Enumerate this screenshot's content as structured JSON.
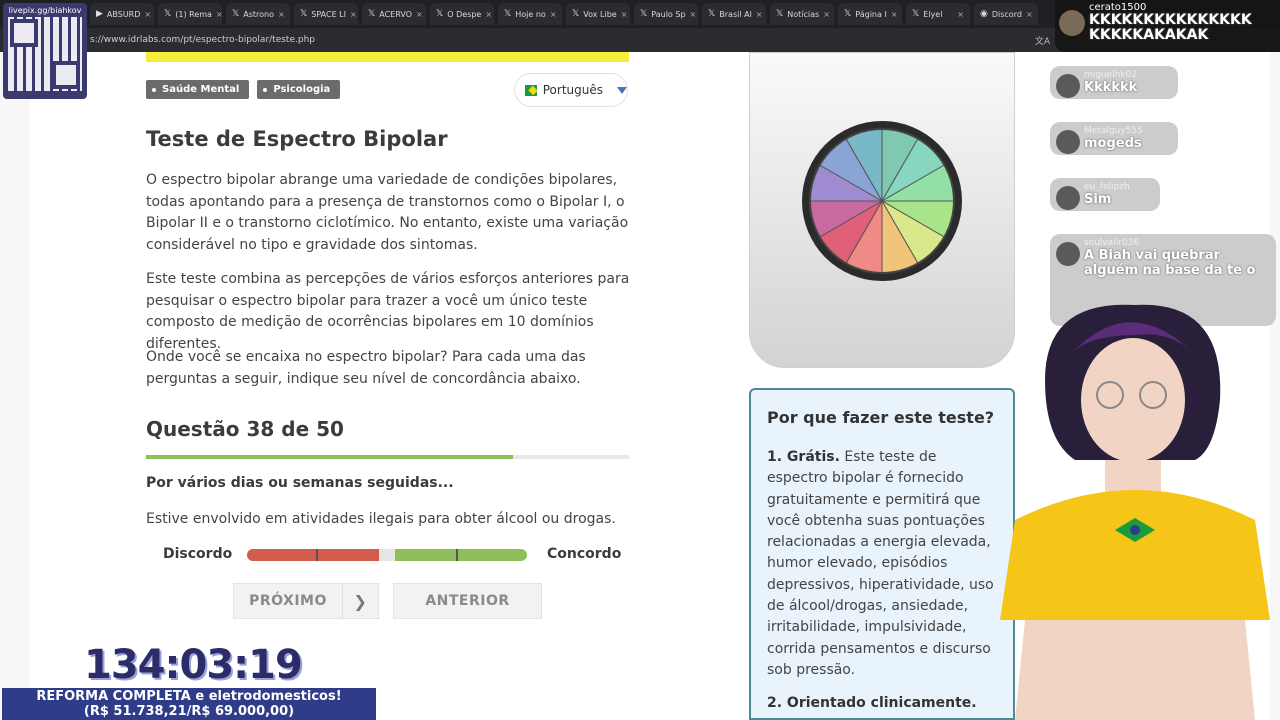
{
  "browser": {
    "tabs": [
      {
        "icon": "youtube-icon",
        "label": "ABSURD"
      },
      {
        "icon": "x-icon",
        "label": "(1) Rema"
      },
      {
        "icon": "x-icon",
        "label": "Astrono"
      },
      {
        "icon": "x-icon",
        "label": "SPACE LI"
      },
      {
        "icon": "x-icon",
        "label": "ACERVO"
      },
      {
        "icon": "x-icon",
        "label": "O Despe"
      },
      {
        "icon": "x-icon",
        "label": "Hoje no"
      },
      {
        "icon": "x-icon",
        "label": "Vox Libe"
      },
      {
        "icon": "x-icon",
        "label": "Paulo Sp"
      },
      {
        "icon": "x-icon",
        "label": "Brasil Al"
      },
      {
        "icon": "x-icon",
        "label": "Notícias"
      },
      {
        "icon": "x-icon",
        "label": "Página I"
      },
      {
        "icon": "x-icon",
        "label": "Elyel"
      },
      {
        "icon": "discord-icon",
        "label": "Discord"
      }
    ],
    "url": "s://www.idrlabs.com/pt/espectro-bipolar/teste.php"
  },
  "page": {
    "tags": [
      "Saúde Mental",
      "Psicologia"
    ],
    "language": "Português",
    "title": "Teste de Espectro Bipolar",
    "intro_1": "O espectro bipolar abrange uma variedade de condições bipolares, todas apontando para a presença de transtornos como o Bipolar I, o Bipolar II e o transtorno ciclotímico. No entanto, existe uma variação considerável no tipo e gravidade dos sintomas.",
    "intro_2": "Este teste combina as percepções de vários esforços anteriores para pesquisar o espectro bipolar para trazer a você um único teste composto de medição de ocorrências bipolares em 10 domínios diferentes.",
    "intro_3": "Onde você se encaixa no espectro bipolar? Para cada uma das perguntas a seguir, indique seu nível de concordância abaixo.",
    "question_number": "Questão 38 de 50",
    "progress": 0.76,
    "question_header": "Por vários dias ou semanas seguidas...",
    "question_text": "Estive envolvido em atividades ilegais para obter álcool ou drogas.",
    "scale_left": "Discordo",
    "scale_right": "Concordo",
    "slider_value": 0.5,
    "next_label": "PRÓXIMO",
    "prev_label": "ANTERIOR"
  },
  "sidebar": {
    "panel_title": "Por que fazer este teste?",
    "item1_title": "1. Grátis.",
    "item1_text": " Este teste de espectro bipolar é fornecido gratuitamente e permitirá que você obtenha suas pontuações relacionadas a energia elevada, humor elevado, episódios depressivos, hiperatividade, uso de álcool/drogas, ansiedade, irritabilidade, impulsividade, corrida pensamentos e discurso sob pressão.",
    "item2_title": "2. Orientado clinicamente."
  },
  "overlay": {
    "qr_handle": "livepix.gg/biahkov",
    "chat": [
      {
        "user": "cerato1500",
        "msg": "KKKKKKKKKKKKKKK KKKKKAKAKAK"
      },
      {
        "user": "miguelhk02",
        "msg": "Kkkkkk"
      },
      {
        "user": "Metalguy555",
        "msg": "mogeds"
      },
      {
        "user": "eu_felipzh",
        "msg": "Sim"
      },
      {
        "user": "soulvalir036",
        "msg": "A Biah vai quebrar alguém na base da te o"
      }
    ],
    "timer": "134:03:19",
    "goal_line1": "REFORMA COMPLETA e eletrodomesticos!",
    "goal_line2": "(R$ 51.738,21/R$ 69.000,00)"
  },
  "colors": {
    "accent_teal": "#4d8a95",
    "progress_green": "#8fbf5a",
    "disagree_red": "#d25b4c",
    "panel_bg": "#e9f3fb",
    "tag_bg": "#6b6b6b"
  }
}
